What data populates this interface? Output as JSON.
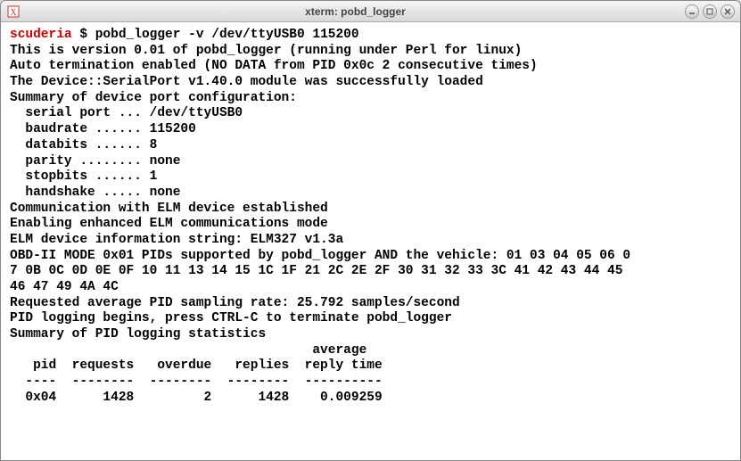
{
  "window": {
    "title": "xterm: pobd_logger"
  },
  "prompt": {
    "host": "scuderia",
    "symbol": "$",
    "command": "pobd_logger -v /dev/ttyUSB0 115200"
  },
  "output": {
    "version_line": "This is version 0.01 of pobd_logger (running under Perl for linux)",
    "auto_term": "Auto termination enabled (NO DATA from PID 0x0c 2 consecutive times)",
    "module_load": "The Device::SerialPort v1.40.0 module was successfully loaded",
    "summary_header": "Summary of device port configuration:",
    "cfg": {
      "serial_port": "  serial port ... /dev/ttyUSB0",
      "baudrate": "  baudrate ...... 115200",
      "databits": "  databits ...... 8",
      "parity": "  parity ........ none",
      "stopbits": "  stopbits ...... 1",
      "handshake": "  handshake ..... none"
    },
    "comm_est": "Communication with ELM device established",
    "enh_mode": "Enabling enhanced ELM communications mode",
    "elm_info": "ELM device information string: ELM327 v1.3a",
    "pids_line1": "OBD-II MODE 0x01 PIDs supported by pobd_logger AND the vehicle: 01 03 04 05 06 0",
    "pids_line2": "7 0B 0C 0D 0E 0F 10 11 13 14 15 1C 1F 21 2C 2E 2F 30 31 32 33 3C 41 42 43 44 45",
    "pids_line3": "46 47 49 4A 4C",
    "sample_rate": "Requested average PID sampling rate: 25.792 samples/second",
    "logging_begin": "PID logging begins, press CTRL-C to terminate pobd_logger",
    "stats_header": "Summary of PID logging statistics",
    "table_hdr1": "                                       average",
    "table_hdr2": "   pid  requests   overdue   replies  reply time",
    "table_sep": "  ----  --------  --------  --------  ----------",
    "table_row": "  0x04      1428         2      1428    0.009259"
  },
  "chart_data": {
    "type": "table",
    "title": "Summary of PID logging statistics",
    "columns": [
      "pid",
      "requests",
      "overdue",
      "replies",
      "average reply time"
    ],
    "rows": [
      {
        "pid": "0x04",
        "requests": 1428,
        "overdue": 2,
        "replies": 1428,
        "avg_reply_time": 0.009259
      }
    ],
    "config": {
      "serial_port": "/dev/ttyUSB0",
      "baudrate": 115200,
      "databits": 8,
      "parity": "none",
      "stopbits": 1,
      "handshake": "none"
    },
    "elm_device": "ELM327 v1.3a",
    "sampling_rate_per_sec": 25.792,
    "supported_pids": [
      "01",
      "03",
      "04",
      "05",
      "06",
      "07",
      "0B",
      "0C",
      "0D",
      "0E",
      "0F",
      "10",
      "11",
      "13",
      "14",
      "15",
      "1C",
      "1F",
      "21",
      "2C",
      "2E",
      "2F",
      "30",
      "31",
      "32",
      "33",
      "3C",
      "41",
      "42",
      "43",
      "44",
      "45",
      "46",
      "47",
      "49",
      "4A",
      "4C"
    ]
  }
}
